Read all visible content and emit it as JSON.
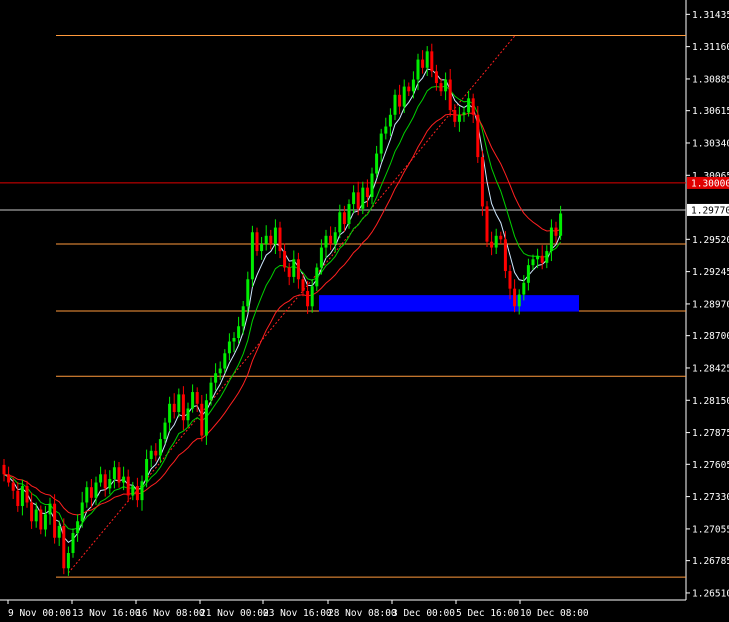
{
  "chart_data": {
    "type": "candlestick",
    "y_axis": {
      "ylim": [
        1.2645,
        1.3154
      ],
      "ticks": [
        "1.31435",
        "1.31160",
        "1.30885",
        "1.30615",
        "1.30340",
        "1.30065",
        "1.29520",
        "1.29245",
        "1.28970",
        "1.28700",
        "1.28425",
        "1.28150",
        "1.27875",
        "1.27605",
        "1.27330",
        "1.27055",
        "1.26785",
        "1.26510"
      ],
      "price_label": "1.29770",
      "price_value": 1.2977,
      "level_label": "1.30000",
      "level_value": 1.3
    },
    "x_axis": {
      "ticks": [
        "9 Nov 00:00",
        "13 Nov 16:00",
        "16 Nov 08:00",
        "21 Nov 00:00",
        "23 Nov 16:00",
        "28 Nov 08:00",
        "3 Dec 00:00",
        "5 Dec 16:00",
        "10 Dec 08:00"
      ]
    },
    "horizontal_levels": [
      {
        "value": 1.31255,
        "color": "#ff9a3c"
      },
      {
        "value": 1.2948,
        "color": "#ff9a3c"
      },
      {
        "value": 1.2891,
        "color": "#ff9a3c"
      },
      {
        "value": 1.28355,
        "color": "#ff9a3c"
      },
      {
        "value": 1.26645,
        "color": "#ff9a3c"
      },
      {
        "value": 1.2977,
        "color": "#c8c8c8"
      },
      {
        "value": 1.3,
        "color": "#e00000"
      }
    ],
    "zone": {
      "from": 1.28905,
      "to": 1.29045,
      "color": "#0000ff"
    },
    "trendline": {
      "p1": [
        14,
        1.2668
      ],
      "p2": [
        111,
        1.3125
      ],
      "color": "#ff2020"
    },
    "colors": {
      "bull": "#00ee00",
      "bear": "#ff0000",
      "ma_fast": "#cfe8ff",
      "ma_mid": "#00d000",
      "ma_slow": "#ff2020"
    },
    "closes": [
      1.2752,
      1.2745,
      1.2738,
      1.2725,
      1.2742,
      1.2728,
      1.2712,
      1.2722,
      1.2705,
      1.2718,
      1.2727,
      1.2698,
      1.2708,
      1.2672,
      1.2685,
      1.2702,
      1.2712,
      1.2728,
      1.2741,
      1.2732,
      1.2745,
      1.2752,
      1.274,
      1.2748,
      1.2758,
      1.2745,
      1.275,
      1.2734,
      1.2742,
      1.273,
      1.2746,
      1.2765,
      1.2772,
      1.2768,
      1.2782,
      1.2796,
      1.2812,
      1.2805,
      1.282,
      1.2798,
      1.2808,
      1.2822,
      1.2812,
      1.2785,
      1.2815,
      1.283,
      1.2838,
      1.2842,
      1.2855,
      1.2865,
      1.2868,
      1.2878,
      1.2895,
      1.2918,
      1.2958,
      1.2942,
      1.2948,
      1.2955,
      1.2948,
      1.2962,
      1.2942,
      1.2928,
      1.292,
      1.2935,
      1.2918,
      1.2908,
      1.2895,
      1.2912,
      1.2928,
      1.2945,
      1.2955,
      1.2948,
      1.2958,
      1.2975,
      1.2965,
      1.2982,
      1.2992,
      1.2978,
      1.2996,
      1.2988,
      1.3008,
      1.3025,
      1.3042,
      1.3048,
      1.3058,
      1.3075,
      1.3065,
      1.3082,
      1.3078,
      1.3088,
      1.3105,
      1.3098,
      1.3112,
      1.3095,
      1.3085,
      1.3078,
      1.3088,
      1.3062,
      1.3052,
      1.3058,
      1.306,
      1.3072,
      1.3058,
      1.3022,
      1.298,
      1.295,
      1.2945,
      1.2955,
      1.2952,
      1.2925,
      1.291,
      1.2895,
      1.2905,
      1.2915,
      1.293,
      1.2935,
      1.2938,
      1.2932,
      1.2942,
      1.2962,
      1.2955,
      1.2974
    ]
  }
}
